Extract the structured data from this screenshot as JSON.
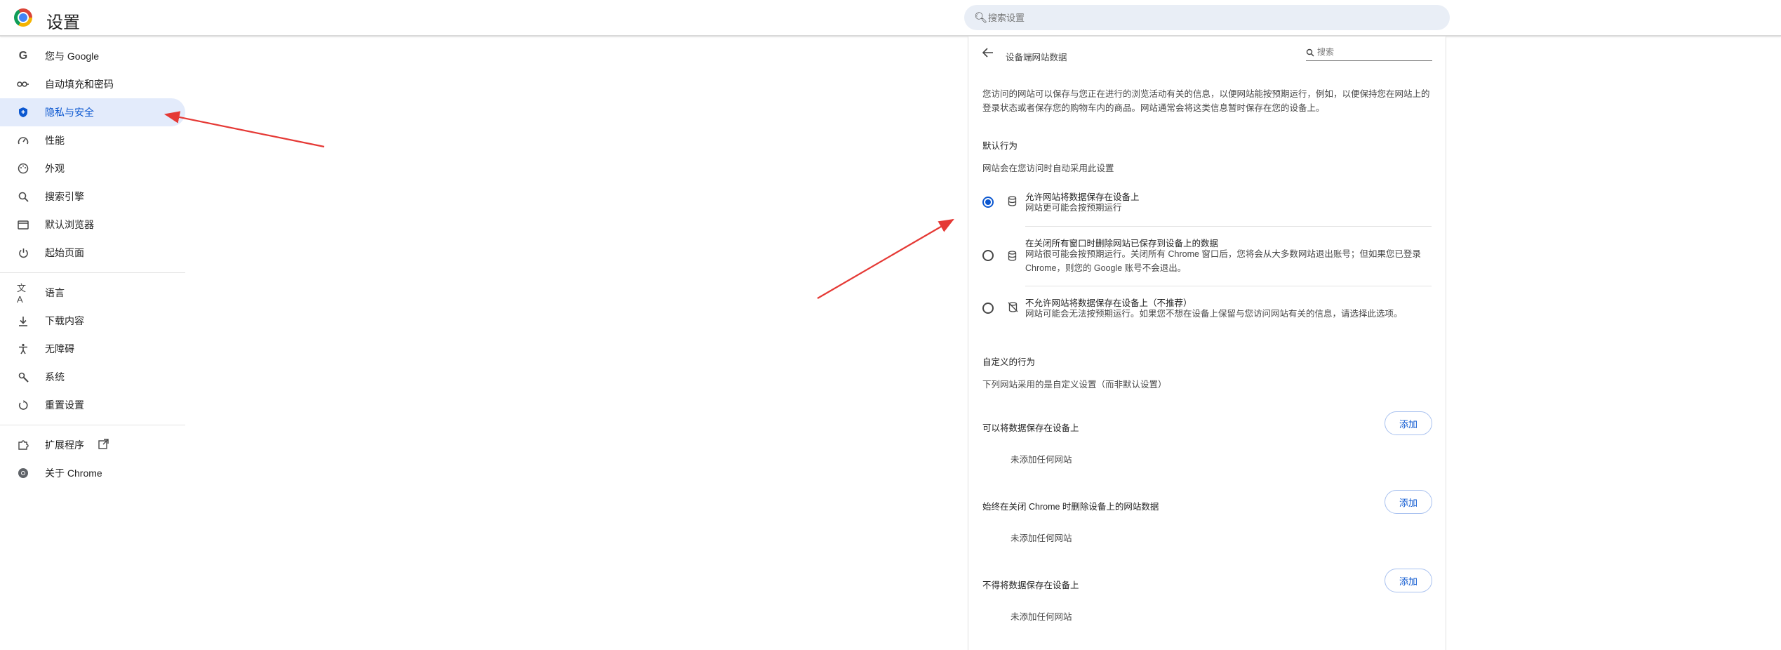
{
  "header": {
    "title": "设置",
    "search_placeholder": "搜索设置"
  },
  "sidebar": {
    "items": [
      {
        "label": "您与 Google",
        "icon": "google-icon"
      },
      {
        "label": "自动填充和密码",
        "icon": "key-icon"
      },
      {
        "label": "隐私与安全",
        "icon": "shield-icon",
        "active": true
      },
      {
        "label": "性能",
        "icon": "speedometer-icon"
      },
      {
        "label": "外观",
        "icon": "palette-icon"
      },
      {
        "label": "搜索引擎",
        "icon": "search-icon"
      },
      {
        "label": "默认浏览器",
        "icon": "browser-icon"
      },
      {
        "label": "起始页面",
        "icon": "power-icon"
      }
    ],
    "items2": [
      {
        "label": "语言",
        "icon": "translate-icon"
      },
      {
        "label": "下载内容",
        "icon": "download-icon"
      },
      {
        "label": "无障碍",
        "icon": "accessibility-icon"
      },
      {
        "label": "系统",
        "icon": "wrench-icon"
      },
      {
        "label": "重置设置",
        "icon": "restore-icon"
      }
    ],
    "items3": [
      {
        "label": "扩展程序",
        "icon": "puzzle-icon"
      },
      {
        "label": "关于 Chrome",
        "icon": "chrome-icon"
      }
    ]
  },
  "page": {
    "title": "设备端网站数据",
    "search_placeholder": "搜索",
    "description": "您访问的网站可以保存与您正在进行的浏览活动有关的信息，以便网站能按预期运行，例如，以便保持您在网站上的登录状态或者保存您的购物车内的商品。网站通常会将这类信息暂时保存在您的设备上。",
    "default_title": "默认行为",
    "default_sub": "网站会在您访问时自动采用此设置",
    "options": [
      {
        "title": "允许网站将数据保存在设备上",
        "desc": "网站更可能会按预期运行",
        "checked": true,
        "icon": "database-icon"
      },
      {
        "title": "在关闭所有窗口时删除网站已保存到设备上的数据",
        "desc": "网站很可能会按预期运行。关闭所有 Chrome 窗口后，您将会从大多数网站退出账号；但如果您已登录 Chrome，则您的 Google 账号不会退出。",
        "checked": false,
        "icon": "database-icon"
      },
      {
        "title": "不允许网站将数据保存在设备上（不推荐）",
        "desc": "网站可能会无法按预期运行。如果您不想在设备上保留与您访问网站有关的信息，请选择此选项。",
        "checked": false,
        "icon": "database-off-icon"
      }
    ],
    "custom_title": "自定义的行为",
    "custom_sub": "下列网站采用的是自定义设置（而非默认设置）",
    "custom_rows": [
      {
        "label": "可以将数据保存在设备上",
        "button": "添加",
        "empty": "未添加任何网站"
      },
      {
        "label": "始终在关闭 Chrome 时删除设备上的网站数据",
        "button": "添加",
        "empty": "未添加任何网站"
      },
      {
        "label": "不得将数据保存在设备上",
        "button": "添加",
        "empty": "未添加任何网站"
      }
    ]
  },
  "colors": {
    "accent": "#0b57d0",
    "active_bg": "#e3ebfb",
    "annotation_arrow": "#e53935"
  }
}
